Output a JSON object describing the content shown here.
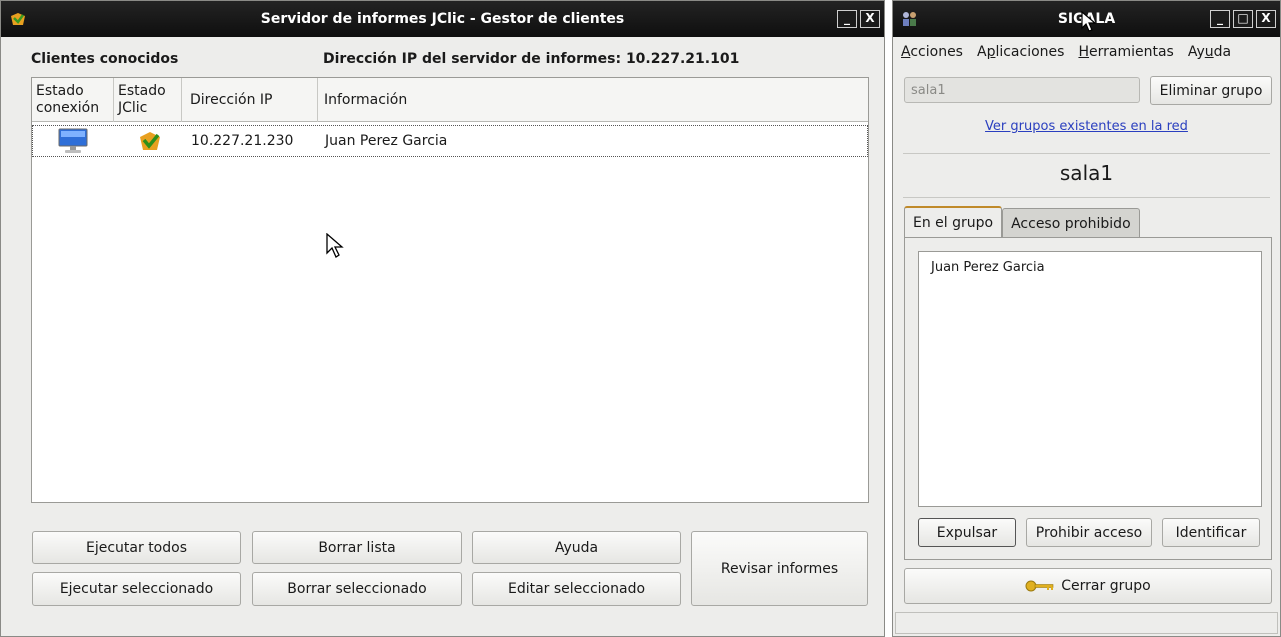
{
  "left_window": {
    "title": "Servidor de informes JClic - Gestor de clientes",
    "minimize": "_",
    "close": "X",
    "known_clients": "Clientes conocidos",
    "server_ip_label": "Dirección IP del servidor de informes: 10.227.21.101",
    "columns": {
      "connection_state": [
        "Estado",
        "conexión"
      ],
      "jclic_state": [
        "Estado",
        "JClic"
      ],
      "ip": "Dirección IP",
      "info": "Información"
    },
    "rows": [
      {
        "ip": "10.227.21.230",
        "info": "Juan Perez Garcia"
      }
    ],
    "buttons": {
      "run_all": "Ejecutar todos",
      "clear_list": "Borrar lista",
      "help": "Ayuda",
      "review_reports": "Revisar informes",
      "run_selected": "Ejecutar seleccionado",
      "delete_selected": "Borrar seleccionado",
      "edit_selected": "Editar seleccionado"
    }
  },
  "right_window": {
    "title": "SIGALA",
    "minimize": "_",
    "maximize": "□",
    "close": "X",
    "menu": [
      {
        "pre": "",
        "mnemonic": "A",
        "post": "cciones"
      },
      {
        "pre": "A",
        "mnemonic": "p",
        "post": "licaciones"
      },
      {
        "pre": "",
        "mnemonic": "H",
        "post": "erramientas"
      },
      {
        "pre": "Ay",
        "mnemonic": "u",
        "post": "da"
      }
    ],
    "group_field": "sala1",
    "delete_group": "Eliminar grupo",
    "view_groups_link": "Ver grupos existentes en la red",
    "group_name": "sala1",
    "tabs": [
      "En el grupo",
      "Acceso prohibido"
    ],
    "members": [
      "Juan Perez Garcia"
    ],
    "buttons": {
      "expel": "Expulsar",
      "forbid": "Prohibir acceso",
      "identify": "Identificar",
      "close_group": "Cerrar grupo"
    }
  },
  "colors": {
    "titlebar": "#141414",
    "window_bg": "#ededeb",
    "link": "#2a3fbf",
    "tab_accent": "#c08a2a"
  }
}
